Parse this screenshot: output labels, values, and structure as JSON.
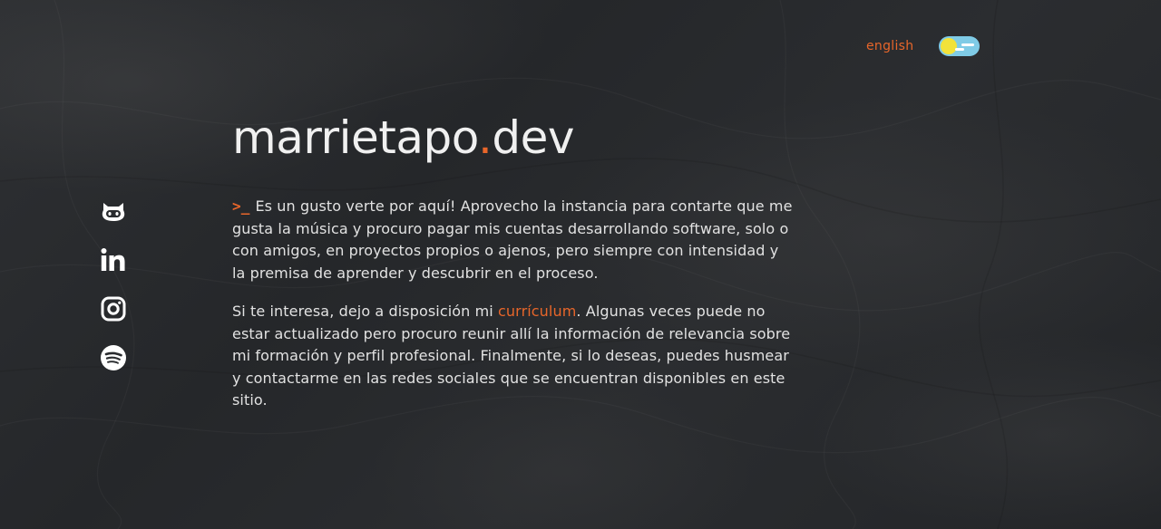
{
  "header": {
    "language_link": "english",
    "theme_toggle": {
      "state": "light",
      "colors": {
        "track": "#7fcbe6",
        "sun": "#f2e23a",
        "cloud": "#ffffff"
      }
    }
  },
  "social": {
    "items": [
      {
        "name": "github",
        "icon": "github-icon"
      },
      {
        "name": "linkedin",
        "icon": "linkedin-icon"
      },
      {
        "name": "instagram",
        "icon": "instagram-icon"
      },
      {
        "name": "spotify",
        "icon": "spotify-icon"
      }
    ]
  },
  "main": {
    "title_name": "marrietapo",
    "title_dot": ".",
    "title_tld": "dev",
    "prompt_symbol": ">_",
    "paragraph1": "Es un gusto verte por aquí! Aprovecho la instancia para contarte que me gusta la música y procuro pagar mis cuentas desarrollando software, solo o con amigos, en proyectos propios o ajenos, pero siempre con intensidad y la premisa de aprender y descubrir en el proceso.",
    "paragraph2_before": "Si te interesa, dejo a disposición mi ",
    "cv_link": "currículum",
    "paragraph2_after": ". Algunas veces puede no estar actualizado pero procuro reunir allí la información de relevancia sobre mi formación y perfil profesional. Finalmente, si lo deseas, puedes husmear y contactarme en las redes sociales que se encuentran disponibles en este sitio."
  },
  "colors": {
    "accent": "#e8662a",
    "text": "#e2e2e2",
    "background": "#2a2c2f"
  }
}
